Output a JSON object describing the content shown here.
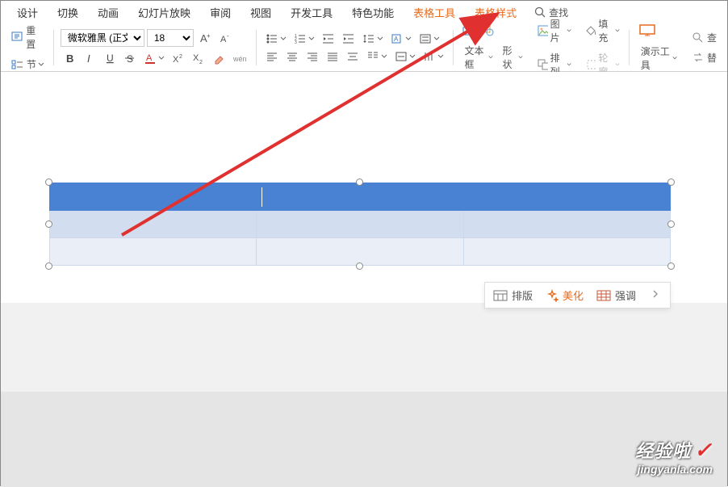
{
  "tabs": {
    "design": "设计",
    "transition": "切换",
    "animation": "动画",
    "slideshow": "幻灯片放映",
    "review": "审阅",
    "view": "视图",
    "developer": "开发工具",
    "special": "特色功能",
    "table_tools": "表格工具",
    "table_style": "表格样式",
    "search": "查找"
  },
  "ribbon": {
    "reset": "重置",
    "section": "节",
    "font_name": "微软雅黑 (正文)",
    "font_size": "18",
    "textbox": "文本框",
    "shape": "形状",
    "arrange": "排列",
    "outline": "轮廓",
    "picture": "图片",
    "fill": "填充",
    "present_tools": "演示工具",
    "find": "查",
    "replace": "替"
  },
  "float": {
    "layout": "排版",
    "beautify": "美化",
    "emphasize": "强调"
  },
  "watermark": {
    "brand": "经验啦",
    "url": "jingyanla.com"
  },
  "chart_data": {
    "type": "table",
    "rows": 3,
    "cols": 3,
    "header_row": true,
    "cells": [
      [
        "",
        "",
        ""
      ],
      [
        "",
        "",
        ""
      ],
      [
        "",
        "",
        ""
      ]
    ]
  }
}
